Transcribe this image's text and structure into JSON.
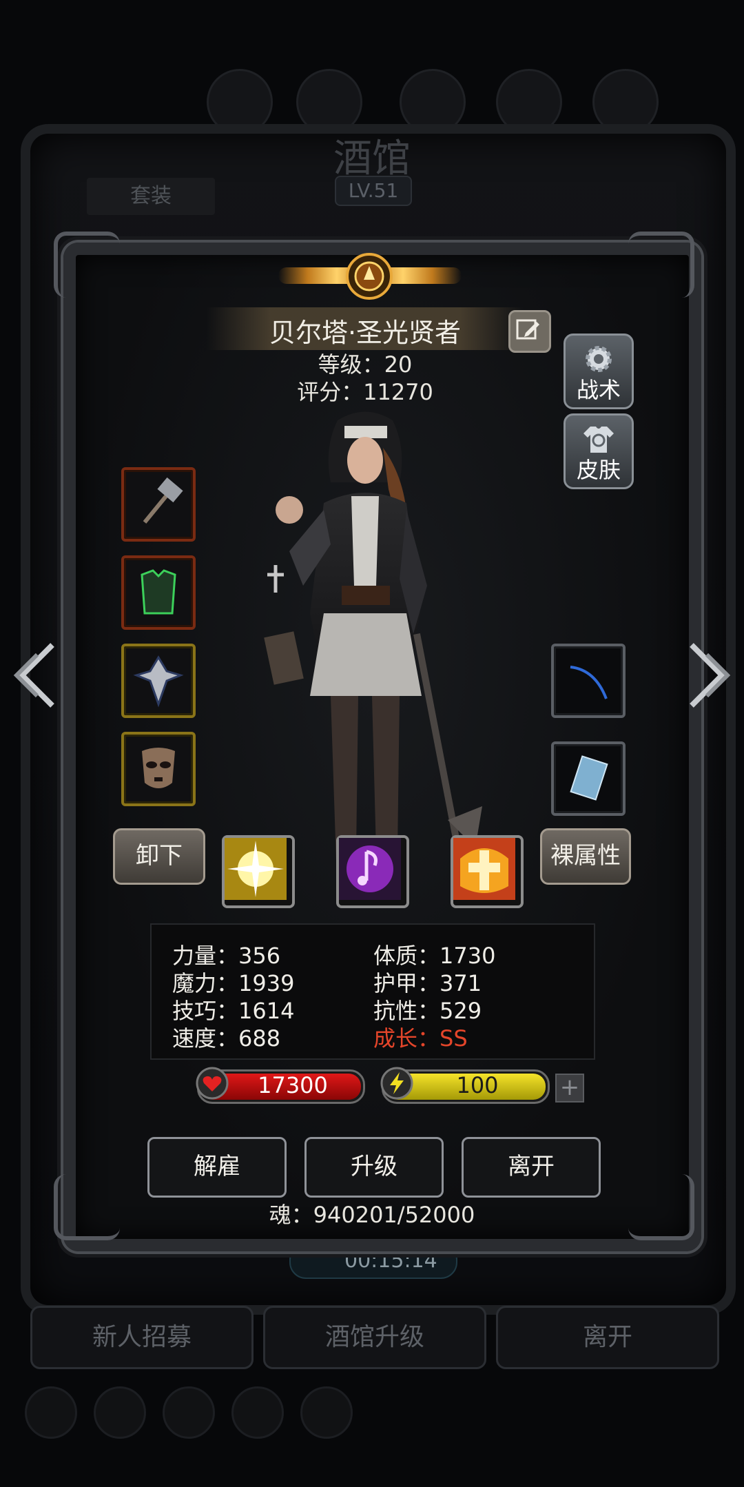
{
  "background": {
    "title": "酒馆",
    "level": "LV.51",
    "tab_set": "套装",
    "timer": "00:15:14",
    "buttons": [
      "新人招募",
      "酒馆升级",
      "离开"
    ]
  },
  "hero": {
    "name": "贝尔塔·圣光贤者",
    "level_label": "等级：20",
    "score_label": "评分：11270"
  },
  "side_buttons": {
    "tactics": "战术",
    "skin": "皮肤"
  },
  "actions": {
    "unequip": "卸下",
    "base_attributes": "裸属性"
  },
  "icons": {
    "left_slots": [
      "hammer-icon",
      "green-armor-icon",
      "shield-amulet-icon",
      "mask-icon"
    ],
    "right_slots": [
      "blue-whip-icon",
      "blue-book-icon"
    ],
    "skills": [
      "holy-burst-icon",
      "music-note-icon",
      "holy-cross-icon"
    ]
  },
  "stats": {
    "left": [
      "力量：356",
      "魔力：1939",
      "技巧：1614",
      "速度：688"
    ],
    "right": [
      "体质：1730",
      "护甲：371",
      "抗性：529"
    ],
    "growth": "成长：SS"
  },
  "bars": {
    "hp": "17300",
    "energy": "100"
  },
  "bottom_buttons": {
    "dismiss": "解雇",
    "upgrade": "升级",
    "leave": "离开"
  },
  "soul": "魂：940201/52000",
  "colors": {
    "growth_red": "#e4452a",
    "hp_red": "#d81414",
    "energy_yellow": "#e8d81e",
    "slot_red_border": "#7a2b12",
    "slot_gold_border": "#8a7418"
  }
}
